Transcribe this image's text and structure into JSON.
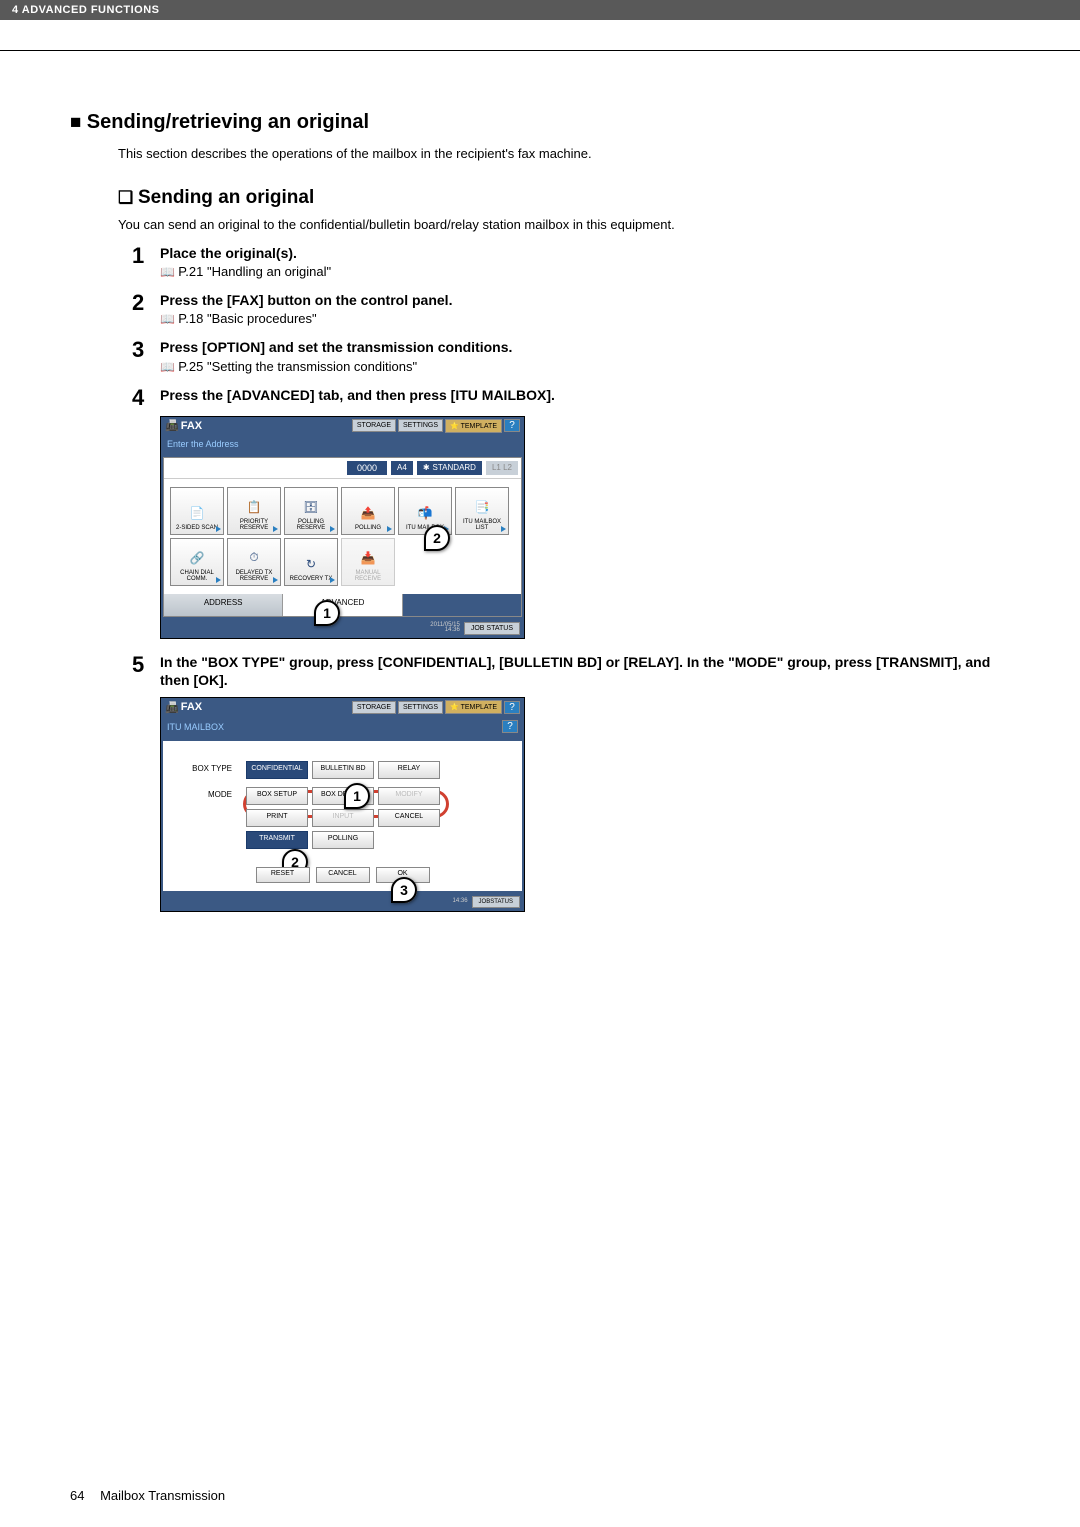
{
  "header": {
    "chapter": "4 ADVANCED FUNCTIONS"
  },
  "section": {
    "h2": "Sending/retrieving an original",
    "intro": "This section describes the operations of the mailbox in the recipient's fax machine.",
    "h3": "Sending an original",
    "subintro": "You can send an original to the confidential/bulletin board/relay station mailbox in this equipment."
  },
  "steps": [
    {
      "num": "1",
      "title": "Place the original(s).",
      "ref": "P.21 \"Handling an original\""
    },
    {
      "num": "2",
      "title": "Press the [FAX] button on the control panel.",
      "ref": "P.18 \"Basic procedures\""
    },
    {
      "num": "3",
      "title": "Press [OPTION] and set the transmission conditions.",
      "ref": "P.25 \"Setting the transmission conditions\""
    },
    {
      "num": "4",
      "title": "Press the [ADVANCED] tab, and then press [ITU MAILBOX].",
      "ref": ""
    },
    {
      "num": "5",
      "title": "In the \"BOX TYPE\" group, press [CONFIDENTIAL], [BULLETIN BD] or [RELAY]. In the \"MODE\" group, press [TRANSMIT], and then [OK].",
      "ref": ""
    }
  ],
  "fax_screen": {
    "title": "FAX",
    "subtitle": "Enter the Address",
    "storage": "STORAGE",
    "settings": "SETTINGS",
    "template": "TEMPLATE",
    "help": "?",
    "count": "0000",
    "papersize": "A4",
    "standard": "STANDARD",
    "indicator": "L1 L2",
    "options": [
      {
        "label": "2-SIDED SCAN"
      },
      {
        "label": "PRIORITY RESERVE"
      },
      {
        "label": "POLLING RESERVE"
      },
      {
        "label": "POLLING"
      },
      {
        "label": "ITU MAILBOX"
      },
      {
        "label": "ITU MAILBOX LIST"
      },
      {
        "label": "CHAIN DIAL COMM."
      },
      {
        "label": "DELAYED TX RESERVE"
      },
      {
        "label": "RECOVERY TX"
      },
      {
        "label": "MANUAL RECEIVE",
        "dim": true
      }
    ],
    "tabs": {
      "address": "ADDRESS",
      "advanced": "ADVANCED"
    },
    "date_top": "2011/05/15",
    "date_bot": "14:36",
    "jobstatus": "JOB STATUS",
    "anno1": "1",
    "anno2": "2"
  },
  "itu_screen": {
    "title": "FAX",
    "subtitle": "ITU MAILBOX",
    "storage": "STORAGE",
    "settings": "SETTINGS",
    "template": "TEMPLATE",
    "help": "?",
    "help2": "?",
    "label_boxtype": "BOX TYPE",
    "label_mode": "MODE",
    "boxtype_btns": [
      {
        "label": "CONFIDENTIAL",
        "sel": true
      },
      {
        "label": "BULLETIN BD"
      },
      {
        "label": "RELAY"
      }
    ],
    "mode_btns": [
      {
        "label": "BOX SETUP"
      },
      {
        "label": "BOX DELETE"
      },
      {
        "label": "MODIFY",
        "dim": true
      },
      {
        "label": "PRINT"
      },
      {
        "label": "INPUT",
        "dim": true
      },
      {
        "label": "CANCEL"
      },
      {
        "label": "TRANSMIT",
        "sel": true
      },
      {
        "label": "POLLING"
      }
    ],
    "reset": "RESET",
    "cancel": "CANCEL",
    "ok": "OK",
    "date_bot": "14:36",
    "jobstatus": "JOBSTATUS",
    "anno1": "1",
    "anno2": "2",
    "anno3": "3"
  },
  "footer": {
    "page": "64",
    "title": "Mailbox Transmission"
  }
}
